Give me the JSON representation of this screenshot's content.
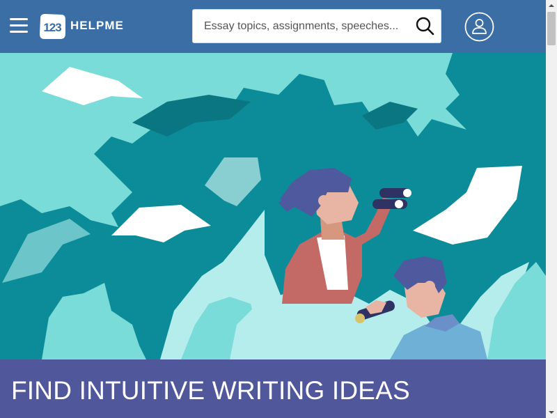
{
  "header": {
    "logo_badge": "123",
    "logo_text": "HELPME",
    "search": {
      "placeholder": "Essay topics, assignments, speeches..."
    },
    "icons": {
      "menu": "hamburger-menu-icon",
      "search": "magnifier-search-icon",
      "user": "user-account-icon"
    }
  },
  "hero": {
    "banner_title": "FIND INTUITIVE WRITING IDEAS"
  },
  "colors": {
    "header_bg": "#3b6ea5",
    "hero_bg": "#0c8c98",
    "foliage_light": "#7adcd8",
    "foliage_pale": "#b5ecec",
    "banner_bg": "#51579b",
    "hair": "#4f5a9e",
    "skin": "#e8b4a4",
    "shirt": "#c46a66"
  }
}
